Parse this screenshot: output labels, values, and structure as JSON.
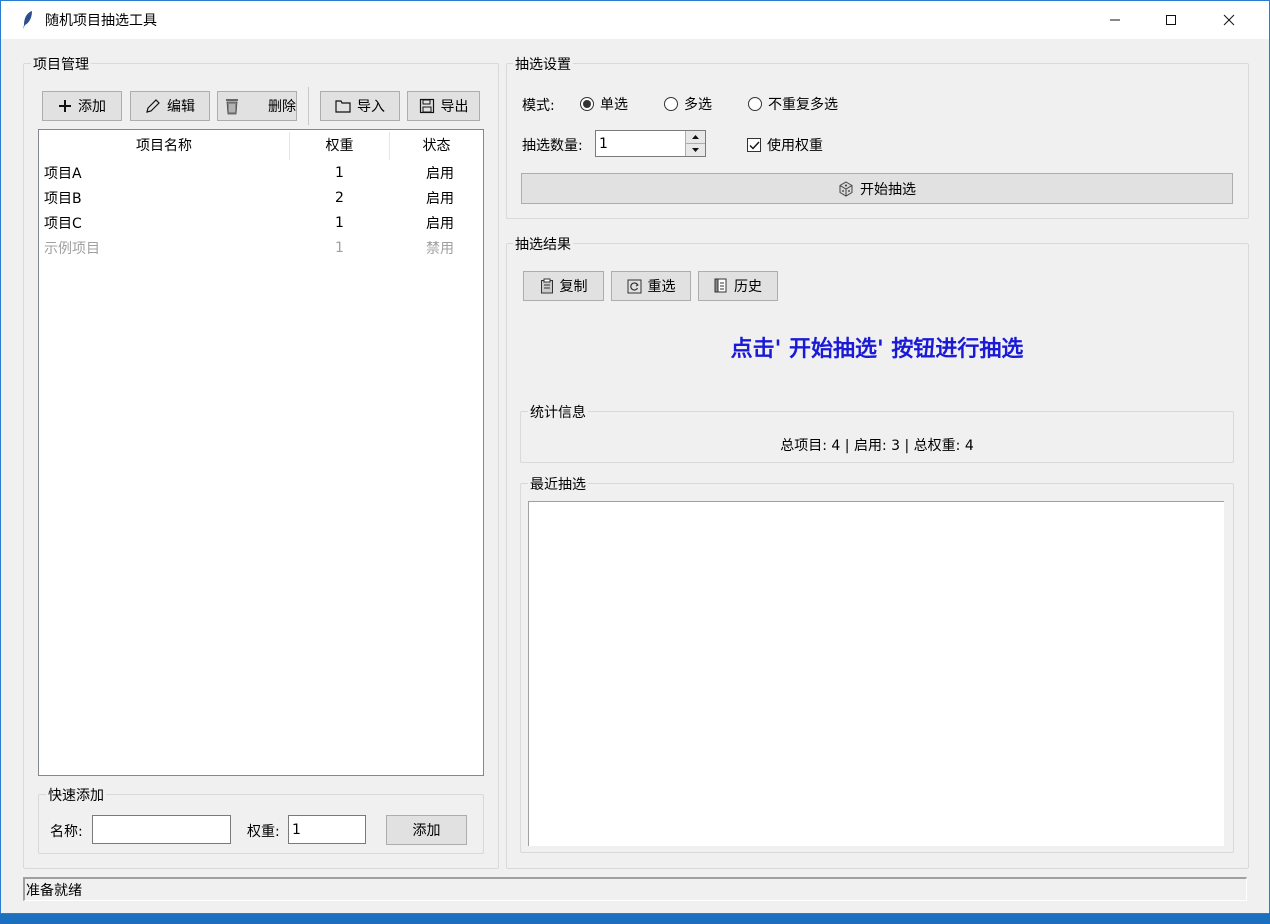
{
  "window": {
    "title": "随机项目抽选工具",
    "controls": {
      "minimize": "—",
      "maximize": "☐",
      "close": "✕"
    }
  },
  "project_panel": {
    "title": "项目管理",
    "toolbar": {
      "add": "添加",
      "edit": "编辑",
      "delete": "删除",
      "import": "导入",
      "export": "导出"
    },
    "columns": {
      "name": "项目名称",
      "weight": "权重",
      "status": "状态"
    },
    "rows": [
      {
        "name": "项目A",
        "weight": "1",
        "status": "启用"
      },
      {
        "name": "项目B",
        "weight": "2",
        "status": "启用"
      },
      {
        "name": "项目C",
        "weight": "1",
        "status": "启用"
      },
      {
        "name": "示例项目",
        "weight": "1",
        "status": "禁用"
      }
    ],
    "quick_add": {
      "title": "快速添加",
      "name_label": "名称:",
      "name_value": "",
      "weight_label": "权重:",
      "weight_value": "1",
      "add_button": "添加"
    }
  },
  "draw_settings": {
    "title": "抽选设置",
    "mode_label": "模式:",
    "modes": [
      "单选",
      "多选",
      "不重复多选"
    ],
    "selected_mode": "单选",
    "count_label": "抽选数量:",
    "count_value": "1",
    "use_weight_label": "使用权重",
    "use_weight_checked": true,
    "start_button": "开始抽选"
  },
  "draw_results": {
    "title": "抽选结果",
    "buttons": {
      "copy": "复制",
      "redraw": "重选",
      "history": "历史"
    },
    "message": "点击' 开始抽选' 按钮进行抽选",
    "message_color": "#1a1ad6",
    "stats": {
      "title": "统计信息",
      "text": "总项目: 4 | 启用: 3 | 总权重: 4"
    },
    "recent": {
      "title": "最近抽选"
    }
  },
  "status_bar": {
    "text": "准备就绪"
  }
}
